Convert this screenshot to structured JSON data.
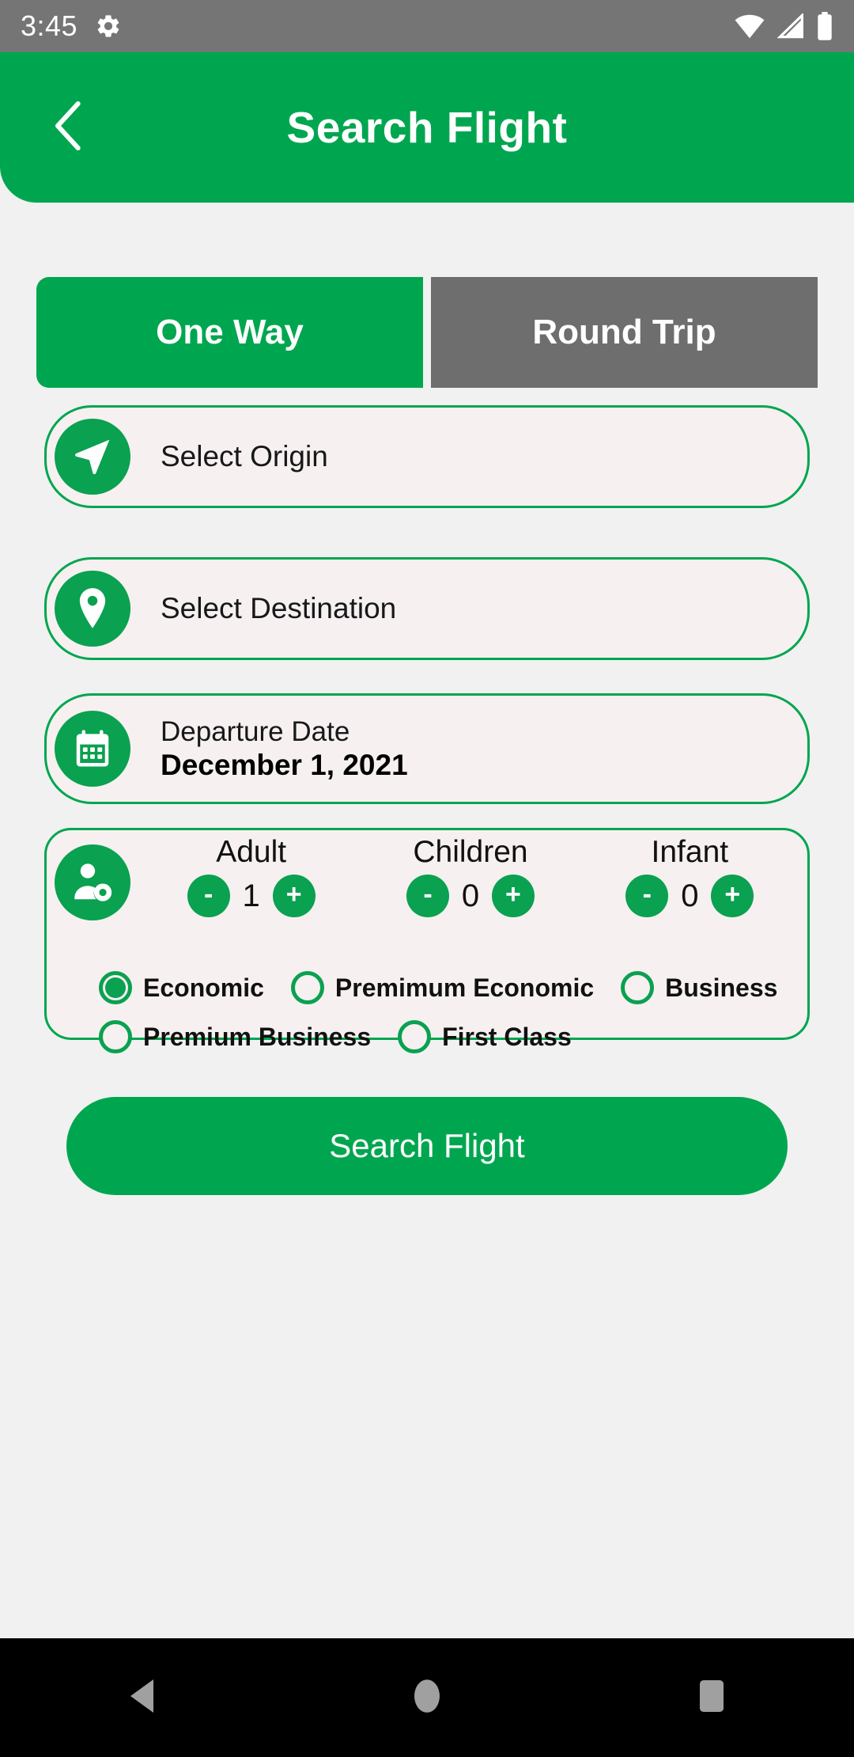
{
  "status_bar": {
    "time": "3:45",
    "icons": [
      "gear-icon",
      "wifi-icon",
      "cell-signal-icon",
      "battery-icon"
    ],
    "background": "#757575"
  },
  "appbar": {
    "title": "Search Flight",
    "back_icon": "chevron-left-icon",
    "background": "#00a64f",
    "text_color": "#ffffff"
  },
  "trip_tabs": {
    "options": [
      {
        "label": "One Way",
        "selected": true
      },
      {
        "label": "Round Trip",
        "selected": false
      }
    ],
    "active_color": "#00a64f",
    "inactive_color": "#6e6e6e"
  },
  "fields": {
    "origin": {
      "text": "Select Origin",
      "icon": "navigation-arrow-icon"
    },
    "destination": {
      "text": "Select Destination",
      "icon": "map-pin-icon"
    },
    "departure": {
      "label": "Departure Date",
      "value": "December 1, 2021",
      "icon": "calendar-icon"
    },
    "border_color": "#00a64f",
    "fill_color": "#f6f0f0"
  },
  "passengers": {
    "icon": "person-settings-icon",
    "counters": [
      {
        "label": "Adult",
        "value": "1",
        "minus": "-",
        "plus": "+"
      },
      {
        "label": "Children",
        "value": "0",
        "minus": "-",
        "plus": "+"
      },
      {
        "label": "Infant",
        "value": "0",
        "minus": "-",
        "plus": "+"
      }
    ]
  },
  "cabin_class": {
    "row1": [
      {
        "label": "Economic",
        "selected": true
      },
      {
        "label": "Premimum Economic",
        "selected": false
      },
      {
        "label": "Business",
        "selected": false
      }
    ],
    "row2": [
      {
        "label": "Premium Business",
        "selected": false
      },
      {
        "label": "First Class",
        "selected": false
      }
    ]
  },
  "search_button": {
    "label": "Search Flight",
    "background": "#00a64f",
    "text_color": "#ffffff"
  },
  "navbar": {
    "background": "#000000",
    "buttons": [
      "back-triangle-icon",
      "home-circle-icon",
      "recents-square-icon"
    ]
  }
}
